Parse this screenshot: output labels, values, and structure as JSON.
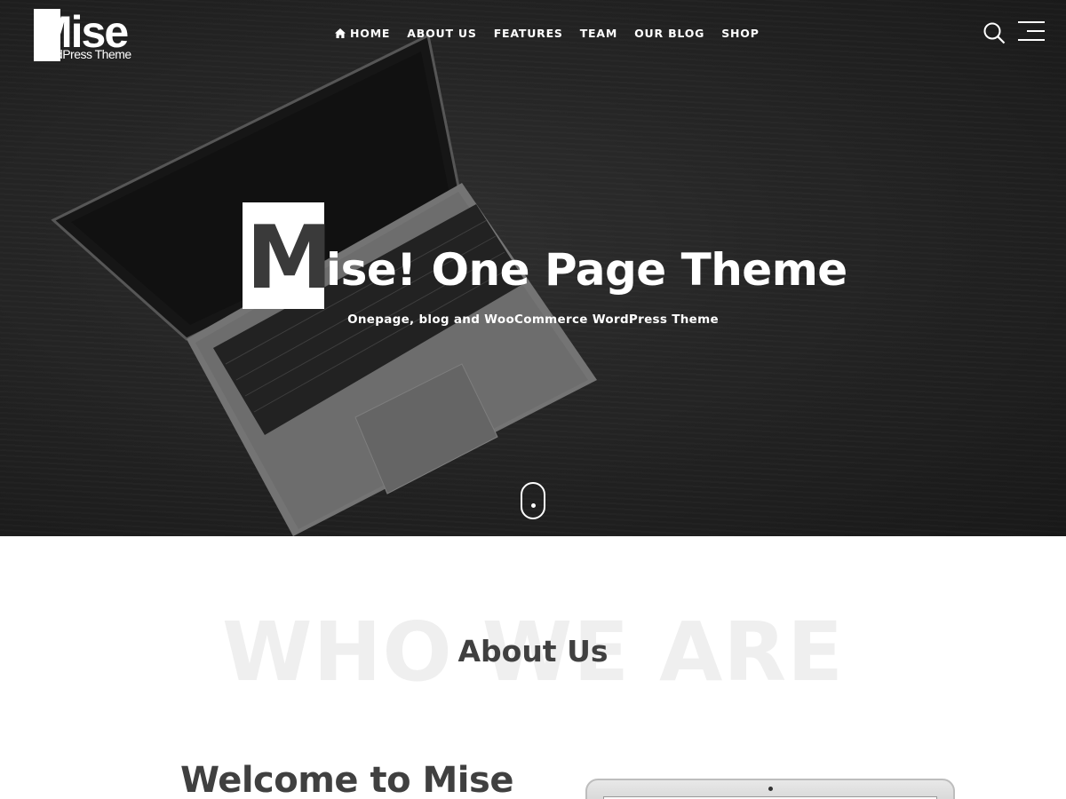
{
  "header": {
    "logo": {
      "text": "Mise",
      "subtitle": "WordPress Theme"
    },
    "nav": [
      {
        "label": "HOME",
        "icon": "home-icon"
      },
      {
        "label": "ABOUT US"
      },
      {
        "label": "FEATURES"
      },
      {
        "label": "TEAM"
      },
      {
        "label": "OUR BLOG"
      },
      {
        "label": "SHOP"
      }
    ],
    "search_icon": "search-icon",
    "menu_icon": "hamburger-menu-icon"
  },
  "hero": {
    "title_initial": "M",
    "title_rest": "ise! One Page Theme",
    "subtitle": "Onepage, blog and WooCommerce WordPress Theme",
    "scroll_icon": "mouse-scroll-icon"
  },
  "about": {
    "background_word": "WHO WE ARE",
    "title": "About Us",
    "welcome_heading": "Welcome to Mise"
  },
  "colors": {
    "hero_bg": "#2b2b2b",
    "text_dark": "#404040",
    "background_word": "#efefef",
    "white": "#ffffff"
  }
}
